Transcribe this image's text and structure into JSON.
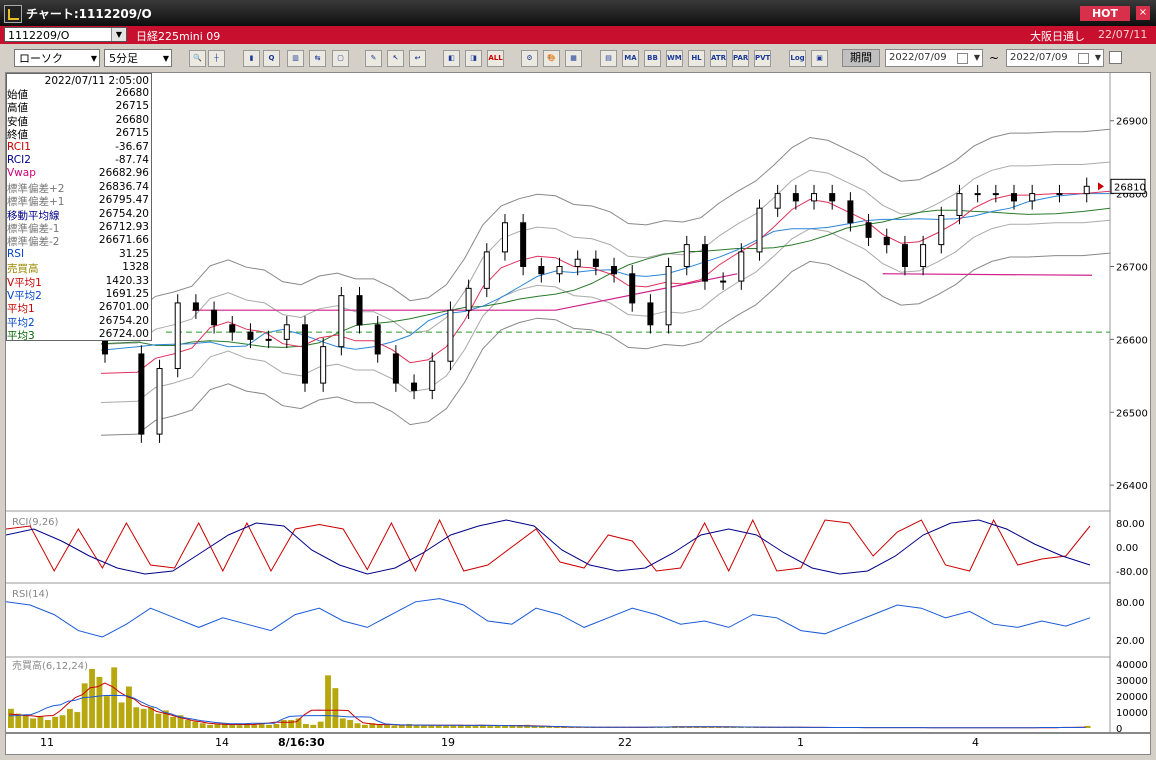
{
  "window": {
    "title": "チャート:1112209/O",
    "hot_label": "HOT",
    "close_label": "×"
  },
  "symbol_bar": {
    "code": "1112209/O",
    "name": "日経225mini 09",
    "market": "大阪日通し",
    "date": "22/07/11"
  },
  "toolbar": {
    "chart_type": "ローソク",
    "interval": "5分足",
    "indicator_buttons": [
      "MA",
      "BB",
      "WMA",
      "HL",
      "ATR",
      "PAR",
      "PVT"
    ],
    "log_label": "Log",
    "all_label": "ALL",
    "period_label": "期間",
    "date_from": "2022/07/09",
    "date_to": "2022/07/09",
    "range_sep": "~"
  },
  "info_panel": {
    "timestamp": "2022/07/11 2:05:00",
    "rows": [
      {
        "label": "始値",
        "value": "26680",
        "color": "#000000"
      },
      {
        "label": "高値",
        "value": "26715",
        "color": "#000000"
      },
      {
        "label": "安値",
        "value": "26680",
        "color": "#000000"
      },
      {
        "label": "終値",
        "value": "26715",
        "color": "#000000"
      },
      {
        "label": "RCI1",
        "value": "-36.67",
        "color": "#cc0000"
      },
      {
        "label": "RCI2",
        "value": "-87.74",
        "color": "#000088"
      },
      {
        "label": "Vwap",
        "value": "26682.96",
        "color": "#cc0077"
      },
      {
        "label": "標準偏差+2",
        "value": "26836.74",
        "color": "#777777"
      },
      {
        "label": "標準偏差+1",
        "value": "26795.47",
        "color": "#777777"
      },
      {
        "label": "移動平均線",
        "value": "26754.20",
        "color": "#000088"
      },
      {
        "label": "標準偏差-1",
        "value": "26712.93",
        "color": "#777777"
      },
      {
        "label": "標準偏差-2",
        "value": "26671.66",
        "color": "#777777"
      },
      {
        "label": "RSI",
        "value": "31.25",
        "color": "#0044cc"
      },
      {
        "label": "売買高",
        "value": "1328",
        "color": "#998800"
      },
      {
        "label": "V平均1",
        "value": "1420.33",
        "color": "#cc0000"
      },
      {
        "label": "V平均2",
        "value": "1691.25",
        "color": "#0044cc"
      },
      {
        "label": "平均1",
        "value": "26701.00",
        "color": "#cc0000"
      },
      {
        "label": "平均2",
        "value": "26754.20",
        "color": "#0044cc"
      },
      {
        "label": "平均3",
        "value": "26724.00",
        "color": "#006600"
      }
    ]
  },
  "main_chart": {
    "y_ticks": [
      "26900",
      "26800",
      "26700",
      "26600",
      "26500",
      "26400"
    ],
    "current_price": "26810",
    "dashed_level": 26610
  },
  "rci_panel": {
    "label": "RCI(9,26)",
    "y_ticks": [
      "80.00",
      "0.00",
      "-80.00"
    ]
  },
  "rsi_panel": {
    "label": "RSI(14)",
    "y_ticks": [
      "80.00",
      "20.00"
    ]
  },
  "volume_panel": {
    "label": "売買高(6,12,24)",
    "y_ticks": [
      "40000",
      "30000",
      "20000",
      "10000",
      "0"
    ]
  },
  "x_axis": {
    "labels": [
      "11",
      "14",
      "8/16:30",
      "19",
      "22",
      "1",
      "4"
    ]
  },
  "chart_data": [
    {
      "type": "line",
      "title": "",
      "series": [
        {
          "name": "",
          "x": [
            0,
            8,
            12,
            16,
            20,
            24,
            28,
            32,
            36,
            40,
            44,
            48,
            52,
            56,
            60,
            64,
            68,
            72,
            76,
            80,
            84,
            88,
            92,
            96,
            100,
            104,
            108,
            112,
            116,
            120,
            124,
            128,
            132,
            136,
            140,
            144,
            148,
            152,
            156,
            160,
            164,
            168,
            172,
            176,
            180,
            184,
            188,
            192,
            196,
            200,
            204,
            210,
            216,
            222
          ],
          "values": [
            26610,
            26580,
            26470,
            26560,
            26650,
            26640,
            26620,
            26610,
            26600,
            26600,
            26620,
            26540,
            26590,
            26660,
            26620,
            26580,
            26540,
            26530,
            26570,
            26640,
            26670,
            26720,
            26760,
            26700,
            26690,
            26700,
            26710,
            26700,
            26690,
            26650,
            26620,
            26700,
            26730,
            26680,
            26680,
            26720,
            26780,
            26800,
            26790,
            26800,
            26790,
            26760,
            26740,
            26730,
            26700,
            26730,
            26770,
            26800,
            26800,
            26800,
            26790,
            26800,
            26800,
            26810
          ]
        }
      ],
      "ylim": [
        26370,
        26960
      ]
    },
    {
      "type": "line",
      "title": "",
      "series": [
        {
          "name": "RCI1",
          "values": [
            60,
            70,
            -80,
            60,
            -70,
            80,
            -60,
            -70,
            80,
            -80,
            80,
            -80,
            60,
            75,
            60,
            -75,
            80,
            -80,
            90,
            -80,
            -60,
            0,
            60,
            -50,
            -70,
            40,
            20,
            -80,
            -70,
            80,
            -80,
            90,
            -80,
            -70,
            90,
            80,
            -30,
            50,
            90,
            -60,
            -80,
            90,
            -60,
            -40,
            -30,
            70
          ]
        },
        {
          "name": "RCI2",
          "values": [
            40,
            60,
            20,
            -30,
            -70,
            -90,
            -80,
            -20,
            40,
            80,
            70,
            -10,
            -60,
            -90,
            -70,
            -20,
            40,
            70,
            90,
            70,
            -10,
            -60,
            -80,
            -70,
            -20,
            40,
            60,
            40,
            -20,
            -70,
            -90,
            -80,
            -30,
            40,
            80,
            90,
            60,
            10,
            -30,
            -60
          ]
        }
      ],
      "ylim": [
        -100,
        100
      ]
    },
    {
      "type": "line",
      "title": "",
      "series": [
        {
          "name": "RSI",
          "values": [
            80,
            75,
            60,
            35,
            25,
            45,
            70,
            55,
            40,
            55,
            45,
            35,
            60,
            70,
            50,
            40,
            60,
            80,
            85,
            75,
            50,
            45,
            70,
            60,
            40,
            55,
            70,
            60,
            45,
            50,
            40,
            60,
            55,
            35,
            30,
            45,
            60,
            75,
            70,
            55,
            65,
            45,
            40,
            50,
            42,
            55
          ]
        }
      ],
      "ylim": [
        0,
        100
      ]
    },
    {
      "type": "bar",
      "title": "",
      "series": [
        {
          "name": "売買高",
          "values": [
            12000,
            9000,
            8000,
            6000,
            7000,
            5000,
            7000,
            8000,
            12000,
            10000,
            28000,
            37000,
            32000,
            20000,
            38000,
            16000,
            26000,
            13000,
            12000,
            13000,
            9000,
            11000,
            7000,
            8000,
            5000,
            4000,
            3000,
            2000,
            2500,
            3000,
            2000,
            1800,
            2000,
            2000,
            2500,
            2000,
            2500,
            5000,
            5000,
            6000,
            2500,
            2000,
            4000,
            33000,
            25000,
            6000,
            5000,
            3000,
            2000,
            3000,
            2000,
            1800,
            1500,
            2000,
            2500,
            2000,
            1500,
            1500,
            1800,
            1500,
            1500,
            2000,
            2000,
            1800,
            1500,
            1200,
            1500,
            1800,
            1500,
            1500,
            2000,
            1500,
            1200,
            1000,
            800,
            800,
            500,
            500,
            400,
            400,
            500,
            800,
            500,
            300,
            400,
            500,
            400,
            300,
            400,
            500,
            1200,
            1000,
            700,
            700,
            700,
            800,
            700,
            1000,
            800,
            700,
            600,
            500,
            400,
            400,
            400,
            500,
            600,
            500,
            400,
            300,
            300,
            300,
            400,
            300,
            300,
            300,
            250,
            250,
            250,
            250,
            250,
            250,
            250,
            250,
            200,
            200,
            200,
            200,
            200,
            200,
            200,
            200,
            200,
            200,
            200,
            200,
            200,
            200,
            200,
            200,
            200,
            200,
            200,
            200,
            200,
            200,
            1328
          ]
        }
      ],
      "ylim": [
        0,
        42000
      ]
    }
  ]
}
